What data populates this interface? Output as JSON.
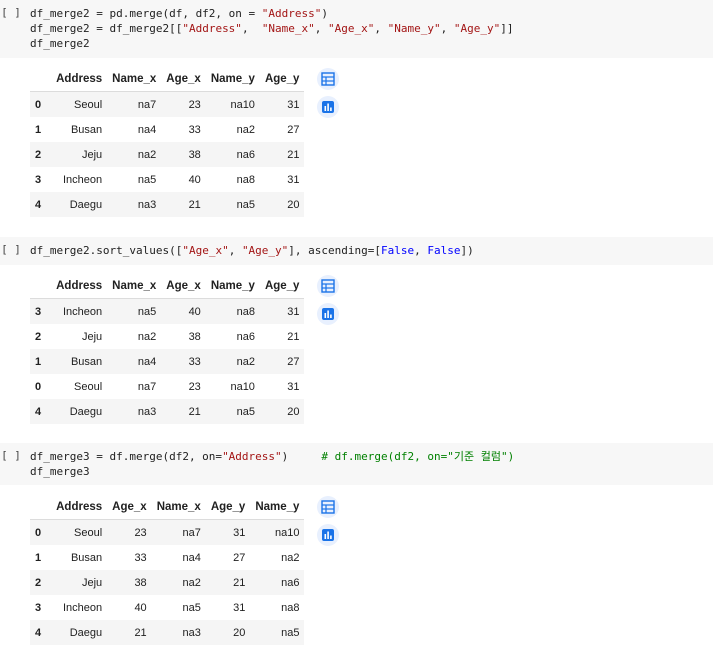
{
  "run_button": "[ ]",
  "cells": [
    {
      "code_lines": [
        [
          {
            "t": "df_merge2 = pd.merge(df, df2, on = ",
            "c": ""
          },
          {
            "t": "\"Address\"",
            "c": "s"
          },
          {
            "t": ")",
            "c": ""
          }
        ],
        [
          {
            "t": "df_merge2 = df_merge2[[",
            "c": ""
          },
          {
            "t": "\"Address\"",
            "c": "s"
          },
          {
            "t": ",  ",
            "c": ""
          },
          {
            "t": "\"Name_x\"",
            "c": "s"
          },
          {
            "t": ", ",
            "c": ""
          },
          {
            "t": "\"Age_x\"",
            "c": "s"
          },
          {
            "t": ", ",
            "c": ""
          },
          {
            "t": "\"Name_y\"",
            "c": "s"
          },
          {
            "t": ", ",
            "c": ""
          },
          {
            "t": "\"Age_y\"",
            "c": "s"
          },
          {
            "t": "]]",
            "c": ""
          }
        ],
        [
          {
            "t": "df_merge2",
            "c": ""
          }
        ]
      ],
      "columns": [
        "",
        "Address",
        "Name_x",
        "Age_x",
        "Name_y",
        "Age_y"
      ],
      "rows": [
        [
          "0",
          "Seoul",
          "na7",
          "23",
          "na10",
          "31"
        ],
        [
          "1",
          "Busan",
          "na4",
          "33",
          "na2",
          "27"
        ],
        [
          "2",
          "Jeju",
          "na2",
          "38",
          "na6",
          "21"
        ],
        [
          "3",
          "Incheon",
          "na5",
          "40",
          "na8",
          "31"
        ],
        [
          "4",
          "Daegu",
          "na3",
          "21",
          "na5",
          "20"
        ]
      ]
    },
    {
      "code_lines": [
        [
          {
            "t": "df_merge2.sort_values([",
            "c": ""
          },
          {
            "t": "\"Age_x\"",
            "c": "s"
          },
          {
            "t": ", ",
            "c": ""
          },
          {
            "t": "\"Age_y\"",
            "c": "s"
          },
          {
            "t": "], ascending=[",
            "c": ""
          },
          {
            "t": "False",
            "c": "kw"
          },
          {
            "t": ", ",
            "c": ""
          },
          {
            "t": "False",
            "c": "kw"
          },
          {
            "t": "])",
            "c": ""
          }
        ]
      ],
      "columns": [
        "",
        "Address",
        "Name_x",
        "Age_x",
        "Name_y",
        "Age_y"
      ],
      "rows": [
        [
          "3",
          "Incheon",
          "na5",
          "40",
          "na8",
          "31"
        ],
        [
          "2",
          "Jeju",
          "na2",
          "38",
          "na6",
          "21"
        ],
        [
          "1",
          "Busan",
          "na4",
          "33",
          "na2",
          "27"
        ],
        [
          "0",
          "Seoul",
          "na7",
          "23",
          "na10",
          "31"
        ],
        [
          "4",
          "Daegu",
          "na3",
          "21",
          "na5",
          "20"
        ]
      ]
    },
    {
      "code_lines": [
        [
          {
            "t": "df_merge3 = df.merge(df2, on=",
            "c": ""
          },
          {
            "t": "\"Address\"",
            "c": "s"
          },
          {
            "t": ")     ",
            "c": ""
          },
          {
            "t": "# df.merge(df2, on=\"기준 컬럼\")",
            "c": "cm"
          }
        ],
        [
          {
            "t": "df_merge3",
            "c": ""
          }
        ]
      ],
      "columns": [
        "",
        "Address",
        "Age_x",
        "Name_x",
        "Age_y",
        "Name_y"
      ],
      "rows": [
        [
          "0",
          "Seoul",
          "23",
          "na7",
          "31",
          "na10"
        ],
        [
          "1",
          "Busan",
          "33",
          "na4",
          "27",
          "na2"
        ],
        [
          "2",
          "Jeju",
          "38",
          "na2",
          "21",
          "na6"
        ],
        [
          "3",
          "Incheon",
          "40",
          "na5",
          "31",
          "na8"
        ],
        [
          "4",
          "Daegu",
          "21",
          "na3",
          "20",
          "na5"
        ]
      ]
    }
  ],
  "icons": {
    "table_icon": "table-icon",
    "chart_icon": "chart-suggest-icon",
    "accent": "#1a73e8"
  }
}
